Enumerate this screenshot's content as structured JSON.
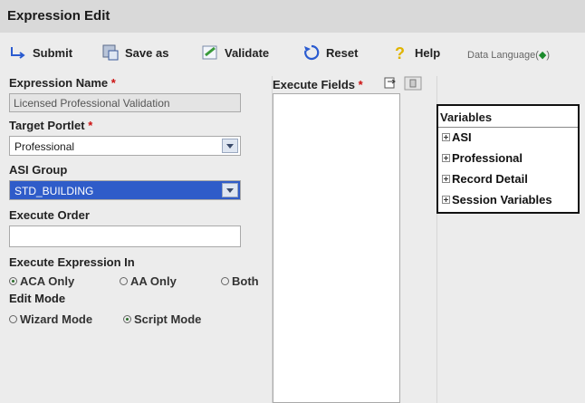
{
  "header": {
    "title": "Expression Edit"
  },
  "toolbar": {
    "submit": "Submit",
    "save_as": "Save as",
    "validate": "Validate",
    "reset": "Reset",
    "help": "Help",
    "data_language": "Data Language(",
    "data_language_mark": "◆",
    "data_language_close": ")"
  },
  "form": {
    "expression_name_label": "Expression Name",
    "required_mark": "*",
    "expression_name_value": "Licensed Professional Validation",
    "target_portlet_label": "Target Portlet",
    "target_portlet_value": "Professional",
    "asi_group_label": "ASI Group",
    "asi_group_value": "STD_BUILDING",
    "execute_order_label": "Execute Order",
    "execute_order_value": "",
    "execute_in_label": "Execute Expression In",
    "execute_in_options": [
      "ACA Only",
      "AA Only",
      "Both"
    ],
    "edit_mode_label": "Edit Mode",
    "edit_mode_options": [
      "Wizard Mode",
      "Script Mode"
    ]
  },
  "execute_fields": {
    "label": "Execute Fields"
  },
  "variables": {
    "title": "Variables",
    "items": [
      "ASI",
      "Professional",
      "Record Detail",
      "Session Variables"
    ]
  },
  "colors": {
    "accent_green": "#1b8a2c",
    "select_highlight": "#2f5cc9",
    "required": "#cc1010"
  }
}
